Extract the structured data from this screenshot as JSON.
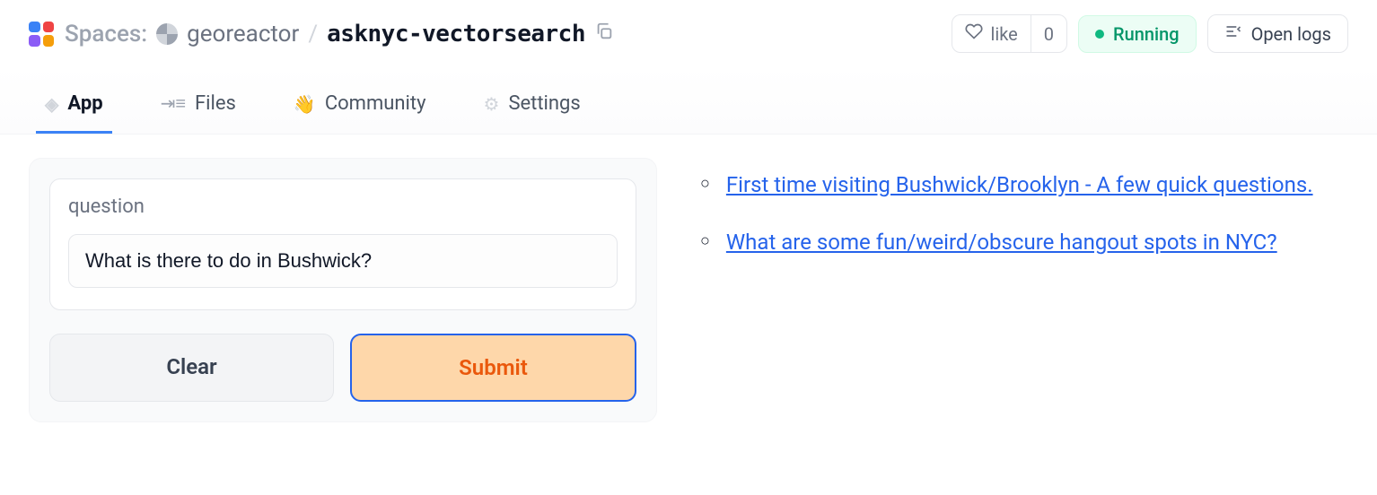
{
  "breadcrumb": {
    "section": "Spaces:",
    "owner": "georeactor",
    "repo": "asknyc-vectorsearch"
  },
  "header": {
    "like_label": "like",
    "like_count": "0",
    "status": "Running",
    "open_logs": "Open logs"
  },
  "tabs": {
    "app": "App",
    "files": "Files",
    "community": "Community",
    "settings": "Settings"
  },
  "form": {
    "label": "question",
    "value": "What is there to do in Bushwick?",
    "clear": "Clear",
    "submit": "Submit"
  },
  "results": [
    "First time visiting Bushwick/Brooklyn - A few quick questions.",
    "What are some fun/weird/obscure hangout spots in NYC?"
  ]
}
